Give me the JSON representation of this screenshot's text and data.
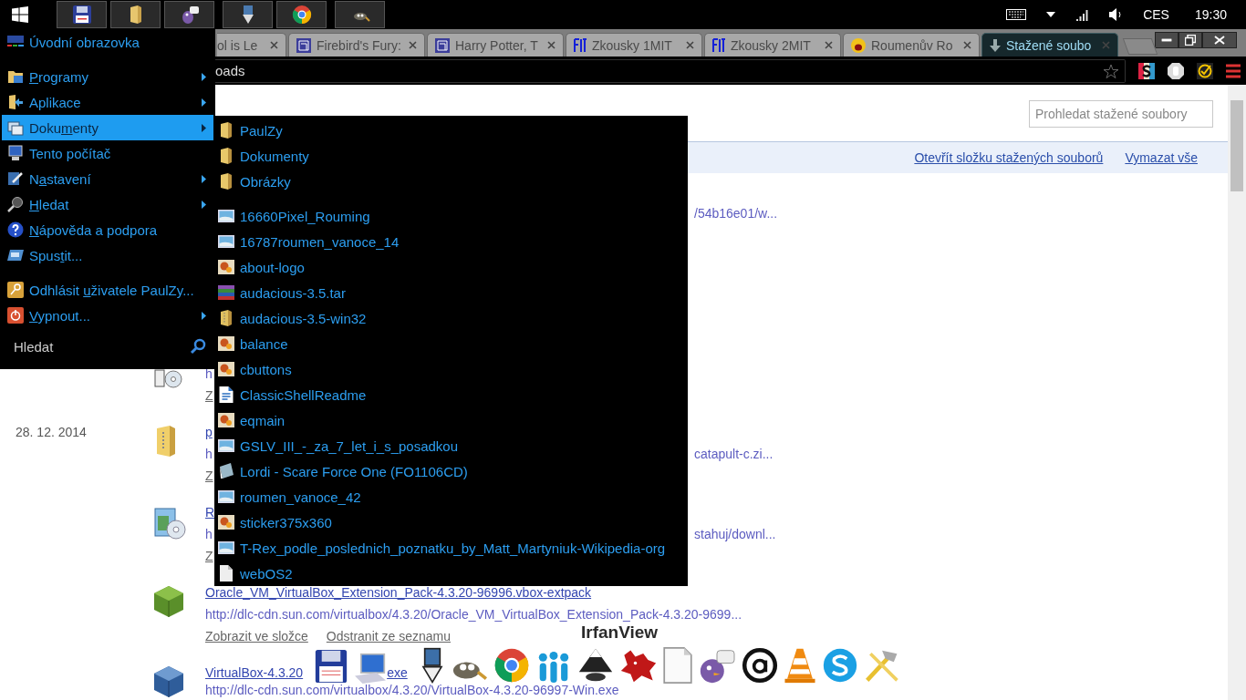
{
  "taskbar": {
    "language": "CES",
    "clock": "19:30"
  },
  "browser": {
    "tabs": [
      {
        "label": "ol is Le",
        "selected": false
      },
      {
        "label": "Firebird's Fury:",
        "selected": false
      },
      {
        "label": "Harry Potter, T",
        "selected": false
      },
      {
        "label": "Zkousky 1MIT",
        "selected": false
      },
      {
        "label": "Zkousky 2MIT",
        "selected": false
      },
      {
        "label": "Roumenův Ro",
        "selected": false
      },
      {
        "label": "Stažené soubo",
        "selected": true
      }
    ],
    "address": "oads"
  },
  "downloads_page": {
    "search": {
      "placeholder": "Prohledat stažené soubory"
    },
    "toolbar_links": [
      "Otevřít složku stažených souborů",
      "Vymazat vše"
    ],
    "items": [
      {
        "url_tail": "/54b16e01/w..."
      },
      {
        "kind": "disc",
        "url": "h",
        "actions": [
          "Z"
        ]
      },
      {
        "date": "28. 12. 2014",
        "kind": "zip",
        "name": "p",
        "url": "h",
        "url_tail": "catapult-c.zi...",
        "actions": [
          "Z"
        ]
      },
      {
        "kind": "installer",
        "name": "R",
        "url": "h",
        "url_tail": "stahuj/downl...",
        "actions": [
          "Z"
        ]
      },
      {
        "kind": "extpack",
        "name": "Oracle_VM_VirtualBox_Extension_Pack-4.3.20-96996.vbox-extpack",
        "url": "http://dlc-cdn.sun.com/virtualbox/4.3.20/Oracle_VM_VirtualBox_Extension_Pack-4.3.20-9699...",
        "actions": [
          "Zobrazit ve složce",
          "Odstranit ze seznamu"
        ]
      },
      {
        "kind": "virtualbox",
        "name": "VirtualBox-4.3.20",
        "name_tail": "exe",
        "url": "http://dlc-cdn.sun.com/virtualbox/4.3.20/VirtualBox-4.3.20-96997-Win.exe"
      }
    ]
  },
  "start_menu": {
    "groups": [
      [
        {
          "before": "Úvodní obrazovka",
          "submenu": false,
          "selected": false
        }
      ],
      [
        {
          "accel": "P",
          "after": "rogramy",
          "submenu": true,
          "selected": false
        },
        {
          "before": "Aplikace",
          "submenu": true,
          "selected": false
        },
        {
          "before": "Doku",
          "accel": "m",
          "after": "enty",
          "submenu": true,
          "selected": true
        },
        {
          "before": "Tento počítač",
          "submenu": false,
          "selected": false
        },
        {
          "before": "N",
          "accel": "a",
          "after": "stavení",
          "submenu": true,
          "selected": false
        },
        {
          "accel": "H",
          "after": "ledat",
          "submenu": true,
          "selected": false
        },
        {
          "accel": "N",
          "after": "ápověda a podpora",
          "submenu": false,
          "selected": false
        },
        {
          "before": "Spus",
          "accel": "t",
          "after": "it...",
          "submenu": false,
          "selected": false
        }
      ],
      [
        {
          "before": "Odhlásit ",
          "accel": "u",
          "after": "živatele PaulZy...",
          "submenu": false,
          "selected": false
        },
        {
          "accel": "V",
          "after": "ypnout...",
          "submenu": true,
          "selected": false
        }
      ]
    ],
    "search": {
      "placeholder": "Hledat"
    }
  },
  "submenu": {
    "groups": [
      [
        {
          "label": "PaulZy",
          "kind": "folder"
        },
        {
          "label": "Dokumenty",
          "kind": "folder"
        },
        {
          "label": "Obrázky",
          "kind": "folder"
        }
      ],
      [
        {
          "label": "16660Pixel_Rouming",
          "kind": "image"
        },
        {
          "label": "16787roumen_vanoce_14",
          "kind": "image"
        },
        {
          "label": "about-logo",
          "kind": "bitmap"
        },
        {
          "label": "audacious-3.5.tar",
          "kind": "archive"
        },
        {
          "label": "audacious-3.5-win32",
          "kind": "zip"
        },
        {
          "label": "balance",
          "kind": "bitmap"
        },
        {
          "label": "cbuttons",
          "kind": "bitmap"
        },
        {
          "label": "ClassicShellReadme",
          "kind": "document"
        },
        {
          "label": "eqmain",
          "kind": "bitmap"
        },
        {
          "label": "GSLV_III_-_za_7_let_i_s_posadkou",
          "kind": "image"
        },
        {
          "label": "Lordi - Scare Force One (FO1106CD)",
          "kind": "disc"
        },
        {
          "label": "roumen_vanoce_42",
          "kind": "image"
        },
        {
          "label": "sticker375x360",
          "kind": "bitmap"
        },
        {
          "label": "T-Rex_podle_poslednich_poznatku_by_Matt_Martyniuk-Wikipedia-org",
          "kind": "image"
        },
        {
          "label": "webOS2",
          "kind": "blank"
        }
      ]
    ]
  },
  "dock": {
    "tooltip": "IrfanView"
  }
}
